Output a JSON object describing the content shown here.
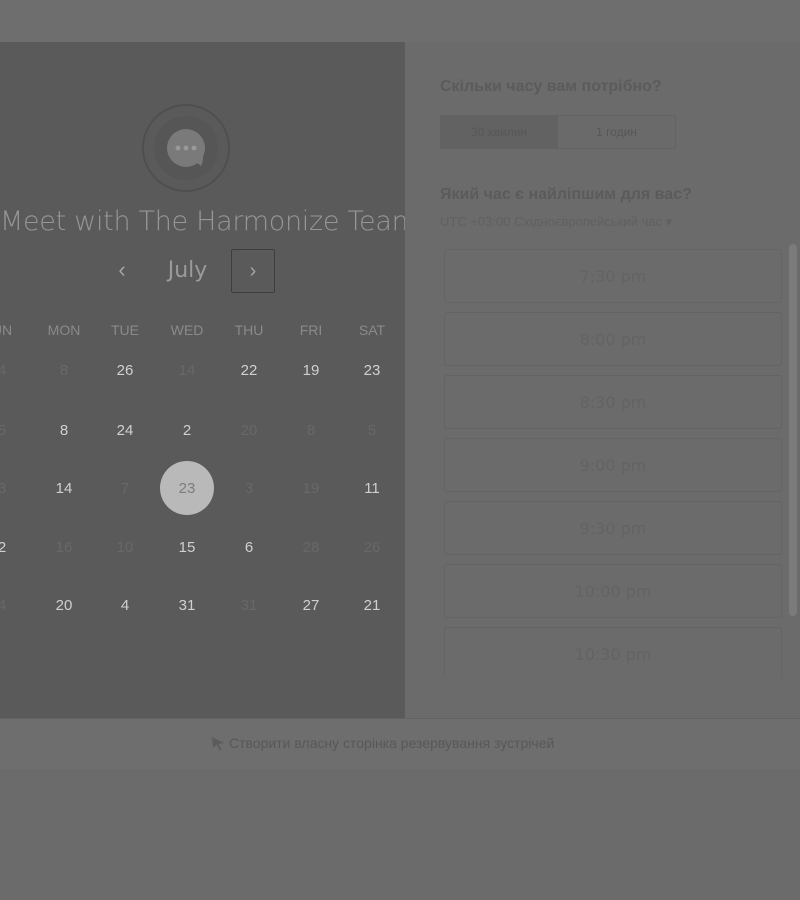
{
  "calendar": {
    "title": "Meet with The Harmonize Team",
    "month": "July",
    "prev": "‹",
    "next": "›",
    "weekdays": [
      "UN",
      "MON",
      "TUE",
      "WED",
      "THU",
      "FRI",
      "SAT"
    ],
    "weeks": [
      [
        {
          "d": "4",
          "on": false
        },
        {
          "d": "8",
          "on": false
        },
        {
          "d": "26",
          "on": true
        },
        {
          "d": "14",
          "on": false
        },
        {
          "d": "22",
          "on": true
        },
        {
          "d": "19",
          "on": true
        },
        {
          "d": "23",
          "on": true
        }
      ],
      [
        {
          "d": "5",
          "on": false
        },
        {
          "d": "8",
          "on": true
        },
        {
          "d": "24",
          "on": true
        },
        {
          "d": "2",
          "on": true
        },
        {
          "d": "20",
          "on": false
        },
        {
          "d": "8",
          "on": false
        },
        {
          "d": "5",
          "on": false
        }
      ],
      [
        {
          "d": "3",
          "on": false
        },
        {
          "d": "14",
          "on": true
        },
        {
          "d": "7",
          "on": false
        },
        {
          "d": "23",
          "on": true,
          "selected": true
        },
        {
          "d": "3",
          "on": false
        },
        {
          "d": "19",
          "on": false
        },
        {
          "d": "11",
          "on": true
        }
      ],
      [
        {
          "d": "2",
          "on": true
        },
        {
          "d": "16",
          "on": false
        },
        {
          "d": "10",
          "on": false
        },
        {
          "d": "15",
          "on": true
        },
        {
          "d": "6",
          "on": true
        },
        {
          "d": "28",
          "on": false
        },
        {
          "d": "26",
          "on": false
        }
      ],
      [
        {
          "d": "4",
          "on": false
        },
        {
          "d": "20",
          "on": true
        },
        {
          "d": "4",
          "on": true
        },
        {
          "d": "31",
          "on": true
        },
        {
          "d": "31",
          "on": false
        },
        {
          "d": "27",
          "on": true
        },
        {
          "d": "21",
          "on": true
        }
      ]
    ]
  },
  "booking": {
    "duration_question": "Скільки часу вам потрібно?",
    "durations": [
      "30 хвилин",
      "1 годин"
    ],
    "time_question": "Який час є найліпшим для вас?",
    "timezone": "UTC +03:00 Східноєвропейський час",
    "timezone_arrow": "▾",
    "slots": [
      "7:30 pm",
      "8:00 pm",
      "8:30 pm",
      "9:00 pm",
      "9:30 pm",
      "10:00 pm",
      "10:30 pm"
    ]
  },
  "footer": {
    "link": "Створити власну сторінка резервування зустрічей"
  },
  "colors": {
    "overlay": "#6b6b6b",
    "calendar_panel": "#5a5a5a",
    "selected_day": "#b9b9b9"
  }
}
